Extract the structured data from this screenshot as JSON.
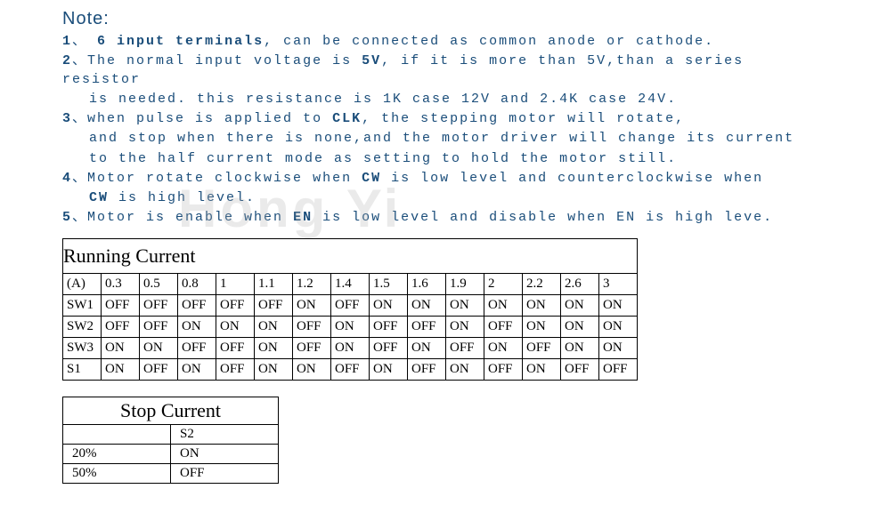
{
  "note": {
    "title": "Note:",
    "items": [
      {
        "num": "1",
        "sep": "、",
        "bold1": "6 input terminals",
        "text1": ", can be connected as common anode or cathode."
      },
      {
        "num": "2",
        "sep": "、",
        "text1": "The normal input voltage is ",
        "bold1": "5V",
        "text2": ", if it is more than 5V,than a series resistor",
        "cont": "is needed. this resistance is 1K case 12V and 2.4K case 24V."
      },
      {
        "num": "3",
        "sep": "、",
        "text1": "when pulse is applied to ",
        "bold1": "CLK",
        "text2": ", the stepping motor will rotate,",
        "cont": "and stop when there is none,and the motor driver will change its current",
        "cont2": "to the half current mode as setting to hold the motor still."
      },
      {
        "num": "4",
        "sep": "、",
        "text1": "Motor rotate clockwise when ",
        "bold1": "CW",
        "text2": " is low level and counterclockwise when",
        "contbold": "CW",
        "cont": " is high level."
      },
      {
        "num": "5",
        "sep": "、",
        "text1": "Motor is enable when ",
        "bold1": "EN",
        "text2": " is low level and disable when EN is high leve."
      }
    ]
  },
  "chart_data": [
    {
      "type": "table",
      "title": "Running Current",
      "header_label": "(A)",
      "columns": [
        "0.3",
        "0.5",
        "0.8",
        "1",
        "1.1",
        "1.2",
        "1.4",
        "1.5",
        "1.6",
        "1.9",
        "2",
        "2.2",
        "2.6",
        "3"
      ],
      "rows": [
        {
          "name": "SW1",
          "values": [
            "OFF",
            "OFF",
            "OFF",
            "OFF",
            "OFF",
            "ON",
            "OFF",
            "ON",
            "ON",
            "ON",
            "ON",
            "ON",
            "ON",
            "ON"
          ]
        },
        {
          "name": "SW2",
          "values": [
            "OFF",
            "OFF",
            "ON",
            "ON",
            "ON",
            "OFF",
            "ON",
            "OFF",
            "OFF",
            "ON",
            "OFF",
            "ON",
            "ON",
            "ON"
          ]
        },
        {
          "name": "SW3",
          "values": [
            "ON",
            "ON",
            "OFF",
            "OFF",
            "ON",
            "OFF",
            "ON",
            "OFF",
            "ON",
            "OFF",
            "ON",
            "OFF",
            "ON",
            "ON"
          ]
        },
        {
          "name": "S1",
          "values": [
            "ON",
            "OFF",
            "ON",
            "OFF",
            "ON",
            "ON",
            "OFF",
            "ON",
            "OFF",
            "ON",
            "OFF",
            "ON",
            "OFF",
            "OFF"
          ]
        }
      ]
    },
    {
      "type": "table",
      "title": "Stop Current",
      "col_label": "S2",
      "rows": [
        {
          "name": "20%",
          "value": "ON"
        },
        {
          "name": "50%",
          "value": "OFF"
        }
      ]
    }
  ],
  "watermark": "Hong Yi"
}
